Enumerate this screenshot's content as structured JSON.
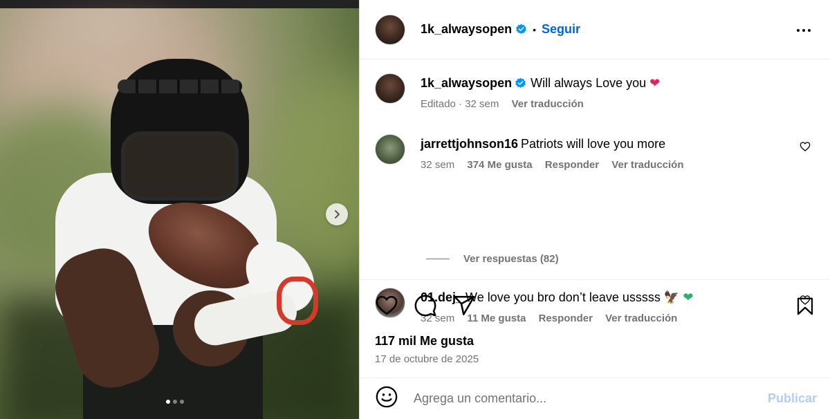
{
  "post": {
    "author": "1k_alwaysopen",
    "follow_label": "Seguir",
    "separator": "•",
    "media": {
      "slide_count": 3,
      "active_slide": 1
    },
    "likes_text": "117 mil Me gusta",
    "date_text": "17 de octubre de 2025"
  },
  "caption": {
    "username": "1k_alwaysopen",
    "text": "Will always Love you",
    "emoji": "❤",
    "edited": "Editado · 32 sem",
    "translate": "Ver traducción"
  },
  "comments": [
    {
      "username": "jarrettjohnson16",
      "text": "Patriots will love you more",
      "time": "32 sem",
      "likes": "374 Me gusta",
      "reply": "Responder",
      "translate": "Ver traducción",
      "replies_text": "Ver respuestas (82)"
    },
    {
      "username": "01.dej_",
      "text": "We love you bro don’t leave usssss",
      "emoji1": "🦅",
      "emoji2": "❤",
      "time": "32 sem",
      "likes": "11 Me gusta",
      "reply": "Responder",
      "translate": "Ver traducción"
    }
  ],
  "composer": {
    "placeholder": "Agrega un comentario...",
    "publish_label": "Publicar"
  },
  "colors": {
    "link_blue": "#0064e0",
    "verified_blue": "#0095f6",
    "muted": "#737373",
    "publish_disabled": "#b3cdf8"
  }
}
